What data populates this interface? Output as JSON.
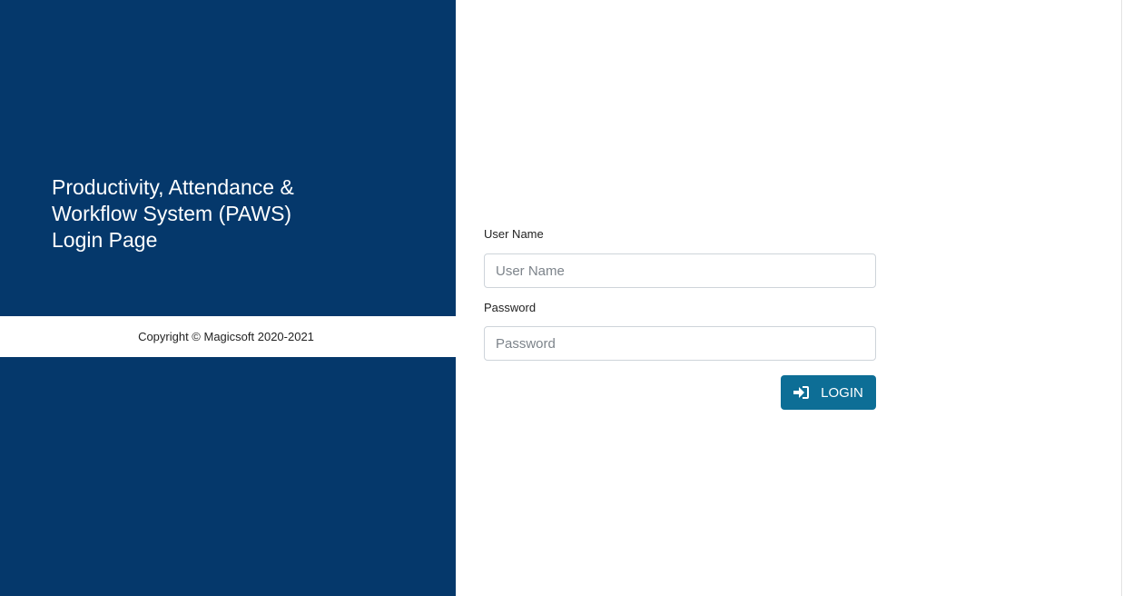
{
  "left_panel": {
    "title_line1": "Productivity, Attendance &",
    "title_line2": "Workflow System (PAWS)",
    "title_line3": "Login Page",
    "copyright": "Copyright © Magicsoft 2020-2021",
    "background_color": "#05386b"
  },
  "login_form": {
    "username_label": "User Name",
    "username_placeholder": "User Name",
    "username_value": "",
    "password_label": "Password",
    "password_placeholder": "Password",
    "password_value": "",
    "login_button_label": "LOGIN",
    "login_button_icon": "sign-in-icon",
    "login_button_color": "#0d6e96"
  }
}
